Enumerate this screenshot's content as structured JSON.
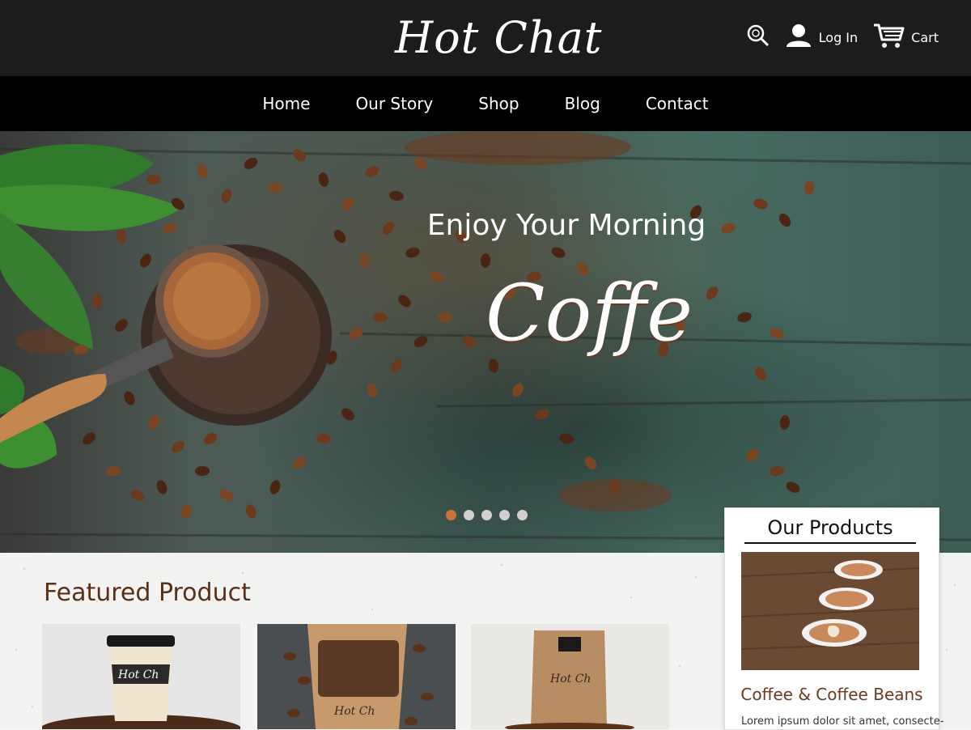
{
  "header": {
    "brand": "Hot Chat",
    "search_icon": "search-icon",
    "login_label": "Log In",
    "cart_label": "Cart"
  },
  "nav": {
    "items": [
      "Home",
      "Our Story",
      "Shop",
      "Blog",
      "Contact"
    ]
  },
  "hero": {
    "headline": "Enjoy Your Morning",
    "script_word": "Coffe",
    "carousel": {
      "count": 5,
      "active_index": 0
    }
  },
  "featured": {
    "title": "Featured Product",
    "cards": [
      {
        "name": "cup"
      },
      {
        "name": "beans-bag"
      },
      {
        "name": "paper-bag"
      }
    ]
  },
  "our_products": {
    "title": "Our Products",
    "item_name": "Coffee & Coffee Beans",
    "item_desc": "Lorem ipsum dolor sit amet, consecte-"
  },
  "colors": {
    "topbar": "#1c1c1c",
    "nav": "#000000",
    "accent": "#c9733b",
    "brown_text": "#5a2f18"
  }
}
